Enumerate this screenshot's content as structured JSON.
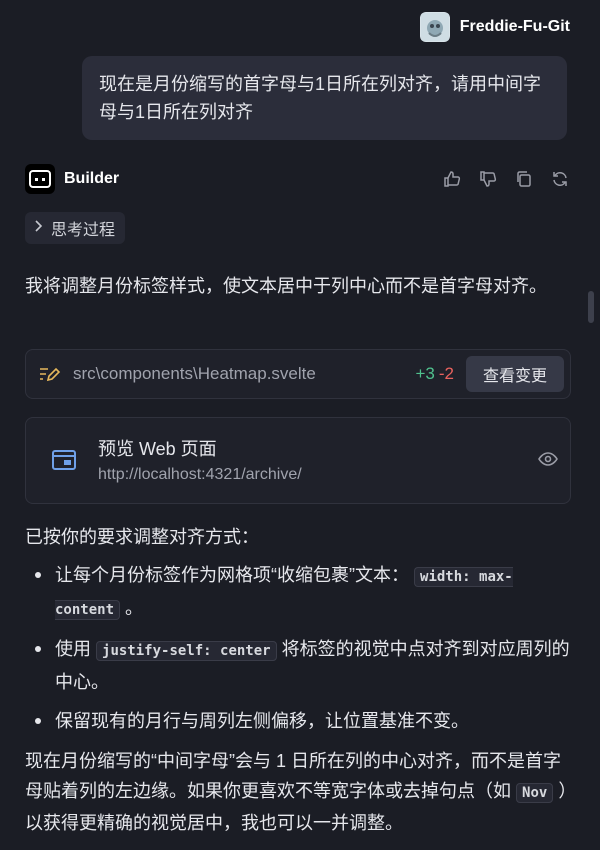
{
  "user": {
    "name": "Freddie-Fu-Git",
    "avatar_icon": "avatar-image"
  },
  "user_message": "现在是月份缩写的首字母与1日所在列对齐，请用中间字母与1日所在列对齐",
  "assistant": {
    "name": "Builder",
    "actions": [
      "thumbs-up-icon",
      "thumbs-down-icon",
      "copy-icon",
      "refresh-icon"
    ],
    "thinking_label": "思考过程",
    "intro": "我将调整月份标签样式，使文本居中于列中心而不是首字母对齐。",
    "file_change": {
      "path": "src\\components\\Heatmap.svelte",
      "added": "+3",
      "removed": "-2",
      "button": "查看变更"
    },
    "preview": {
      "title": "预览 Web 页面",
      "url": "http://localhost:4321/archive/"
    },
    "summary_heading": "已按你的要求调整对齐方式：",
    "bullets": [
      {
        "before": "让每个月份标签作为网格项“收缩包裹”文本：",
        "code": "width: max-content",
        "after": "。"
      },
      {
        "before": "使用",
        "code": "justify-self: center",
        "after": "将标签的视觉中点对齐到对应周列的中心。"
      },
      {
        "before": "保留现有的月行与周列左侧偏移，让位置基准不变。",
        "code": "",
        "after": ""
      }
    ],
    "closing_before": "现在月份缩写的“中间字母”会与 1 日所在列的中心对齐，而不是首字母贴着列的左边缘。如果你更喜欢不等宽字体或去掉句点（如",
    "closing_code": "Nov",
    "closing_after": "）以获得更精确的视觉居中，我也可以一并调整。"
  },
  "colors": {
    "background": "#1b1d25",
    "bubble": "#2b2d3a",
    "added": "#4fc08d",
    "removed": "#e8625e",
    "preview_icon": "#6fa0e8"
  }
}
